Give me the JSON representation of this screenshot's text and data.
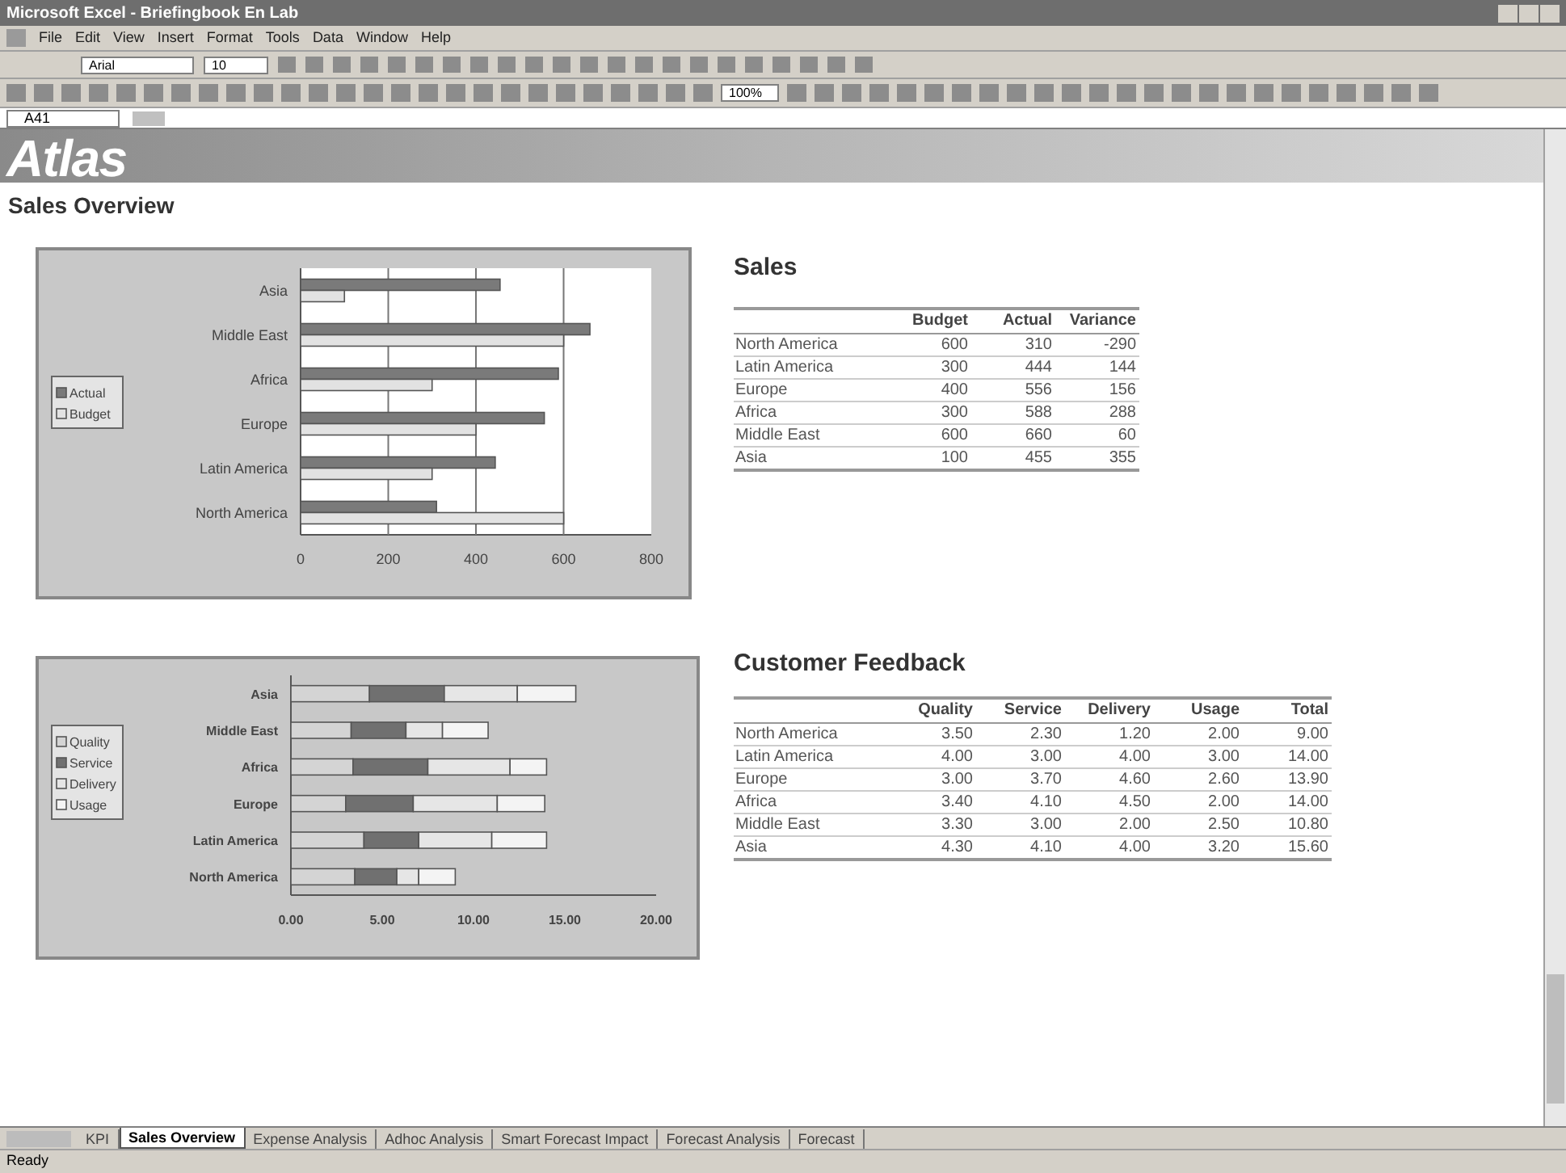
{
  "window": {
    "title": "Microsoft Excel - Briefingbook En Lab"
  },
  "menu_bar": {
    "items": [
      "File",
      "Edit",
      "View",
      "Insert",
      "Format",
      "Tools",
      "Data",
      "Window",
      "Help"
    ]
  },
  "formatting_toolbar": {
    "font": "Arial",
    "size": "10"
  },
  "standard_toolbar": {
    "zoom": "100%"
  },
  "formula_bar": {
    "name_box": "A41"
  },
  "sheet": {
    "logo": "Atlas",
    "heading": "Sales Overview",
    "sales": {
      "title": "Sales",
      "chart_data": {
        "type": "bar",
        "orientation": "horizontal",
        "categories": [
          "Asia",
          "Middle East",
          "Africa",
          "Europe",
          "Latin America",
          "North America"
        ],
        "series": [
          {
            "name": "Actual",
            "color": "#7a7a7a",
            "values": [
              455,
              660,
              588,
              556,
              444,
              310
            ]
          },
          {
            "name": "Budget",
            "color": "#e2e2e2",
            "values": [
              100,
              600,
              300,
              400,
              300,
              600
            ]
          }
        ],
        "xlim": [
          0,
          800
        ],
        "xticks": [
          0,
          200,
          400,
          600,
          800
        ],
        "grid": true,
        "legend": true
      },
      "table": {
        "columns": [
          "Budget",
          "Actual",
          "Variance"
        ],
        "rows": [
          {
            "label": "North America",
            "cells": [
              "600",
              "310",
              "-290"
            ]
          },
          {
            "label": "Latin America",
            "cells": [
              "300",
              "444",
              "144"
            ]
          },
          {
            "label": "Europe",
            "cells": [
              "400",
              "556",
              "156"
            ]
          },
          {
            "label": "Africa",
            "cells": [
              "300",
              "588",
              "288"
            ]
          },
          {
            "label": "Middle East",
            "cells": [
              "600",
              "660",
              "60"
            ]
          },
          {
            "label": "Asia",
            "cells": [
              "100",
              "455",
              "355"
            ]
          }
        ]
      }
    },
    "feedback": {
      "title": "Customer Feedback",
      "chart_data": {
        "type": "bar",
        "orientation": "horizontal",
        "stacked": true,
        "categories": [
          "Asia",
          "Middle East",
          "Africa",
          "Europe",
          "Latin America",
          "North America"
        ],
        "series": [
          {
            "name": "Quality",
            "color": "#d4d4d4",
            "values": [
              4.3,
              3.3,
              3.4,
              3.0,
              4.0,
              3.5
            ]
          },
          {
            "name": "Service",
            "color": "#707070",
            "values": [
              4.1,
              3.0,
              4.1,
              3.7,
              3.0,
              2.3
            ]
          },
          {
            "name": "Delivery",
            "color": "#e6e6e6",
            "values": [
              4.0,
              2.0,
              4.5,
              4.6,
              4.0,
              1.2
            ]
          },
          {
            "name": "Usage",
            "color": "#f4f4f4",
            "values": [
              3.2,
              2.5,
              2.0,
              2.6,
              3.0,
              2.0
            ]
          }
        ],
        "legend": true,
        "xlim": [
          0,
          20
        ],
        "xticks": [
          {
            "value": 0,
            "label": "0.00"
          },
          {
            "value": 5,
            "label": "5.00"
          },
          {
            "value": 10,
            "label": "10.00"
          },
          {
            "value": 15,
            "label": "15.00"
          },
          {
            "value": 20,
            "label": "20.00"
          }
        ]
      },
      "table": {
        "columns": [
          "Quality",
          "Service",
          "Delivery",
          "Usage",
          "Total"
        ],
        "rows": [
          {
            "label": "North America",
            "cells": [
              "3.50",
              "2.30",
              "1.20",
              "2.00",
              "9.00"
            ]
          },
          {
            "label": "Latin America",
            "cells": [
              "4.00",
              "3.00",
              "4.00",
              "3.00",
              "14.00"
            ]
          },
          {
            "label": "Europe",
            "cells": [
              "3.00",
              "3.70",
              "4.60",
              "2.60",
              "13.90"
            ]
          },
          {
            "label": "Africa",
            "cells": [
              "3.40",
              "4.10",
              "4.50",
              "2.00",
              "14.00"
            ]
          },
          {
            "label": "Middle East",
            "cells": [
              "3.30",
              "3.00",
              "2.00",
              "2.50",
              "10.80"
            ]
          },
          {
            "label": "Asia",
            "cells": [
              "4.30",
              "4.10",
              "4.00",
              "3.20",
              "15.60"
            ]
          }
        ]
      }
    }
  },
  "sheet_tabs": [
    {
      "label": "KPI",
      "selected": false
    },
    {
      "label": "Sales Overview",
      "selected": true
    },
    {
      "label": "Expense Analysis",
      "selected": false
    },
    {
      "label": "Adhoc Analysis",
      "selected": false
    },
    {
      "label": "Smart Forecast Impact",
      "selected": false
    },
    {
      "label": "Forecast Analysis",
      "selected": false
    },
    {
      "label": "Forecast",
      "selected": false
    }
  ],
  "status_bar": {
    "text": "Ready"
  }
}
